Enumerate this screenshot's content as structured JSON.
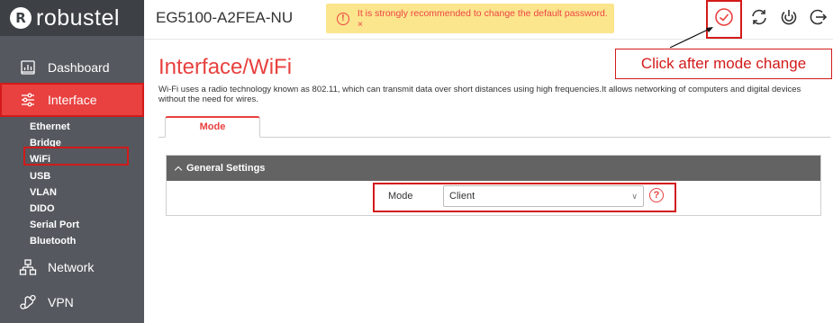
{
  "brand": {
    "name": "robustel",
    "mark": "R"
  },
  "sidebar": {
    "items": [
      {
        "label": "Dashboard",
        "icon": "dashboard-icon"
      },
      {
        "label": "Interface",
        "icon": "sliders-icon"
      },
      {
        "label": "Network",
        "icon": "network-icon"
      },
      {
        "label": "VPN",
        "icon": "vpn-icon"
      }
    ],
    "submenu": [
      "Ethernet",
      "Bridge",
      "WiFi",
      "USB",
      "VLAN",
      "DIDO",
      "Serial Port",
      "Bluetooth"
    ],
    "active_item": "Interface",
    "active_subitem": "WiFi"
  },
  "header": {
    "device_name": "EG5100-A2FEA-NU",
    "alert_text": "It is strongly recommended to change the default password. ×",
    "alert_icon": "exclamation-icon",
    "icons": [
      "apply-check-icon",
      "refresh-icon",
      "reboot-icon",
      "logout-icon"
    ]
  },
  "annotation": {
    "callout_text": "Click after mode change"
  },
  "page": {
    "title": "Interface/WiFi",
    "description": "Wi-Fi uses a radio technology known as 802.11, which can transmit data over short distances using high frequencies.It allows networking of computers and digital devices without the need for wires.",
    "tabs": [
      {
        "label": "Mode",
        "active": true
      }
    ]
  },
  "panel": {
    "title": "General Settings",
    "fields": [
      {
        "label": "Mode",
        "value": "Client",
        "help": "?"
      }
    ]
  },
  "colors": {
    "accent": "#e8413f",
    "sidebar": "#55595f",
    "alert_bg": "#fbe58d",
    "highlight": "#d31a1a"
  }
}
